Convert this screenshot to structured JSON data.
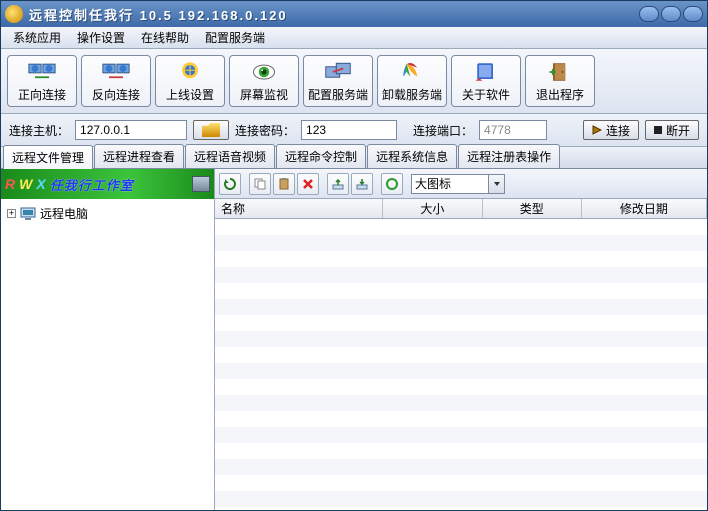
{
  "title": "远程控制任我行  10.5   192.168.0.120",
  "menu": {
    "app": "系统应用",
    "op": "操作设置",
    "help": "在线帮助",
    "cfgsrv": "配置服务端"
  },
  "tools": {
    "t0": "正向连接",
    "t1": "反向连接",
    "t2": "上线设置",
    "t3": "屏幕监视",
    "t4": "配置服务端",
    "t5": "卸载服务端",
    "t6": "关于软件",
    "t7": "退出程序"
  },
  "conn": {
    "host_label": "连接主机：",
    "host_value": "127.0.0.1",
    "pwd_label": "连接密码：",
    "pwd_value": "123",
    "port_label": "连接端口：",
    "port_value": "4778",
    "btn_connect": "连接",
    "btn_disconnect": "断开"
  },
  "tabs": {
    "t0": "远程文件管理",
    "t1": "远程进程查看",
    "t2": "远程语音视频",
    "t3": "远程命令控制",
    "t4": "远程系统信息",
    "t5": "远程注册表操作"
  },
  "banner": {
    "R": "R",
    "W": "W",
    "X": "X",
    "text": "任我行工作室"
  },
  "tree": {
    "root": "远程电脑"
  },
  "filetoolbar": {
    "view_value": "大图标"
  },
  "columns": {
    "name": "名称",
    "size": "大小",
    "type": "类型",
    "date": "修改日期"
  }
}
